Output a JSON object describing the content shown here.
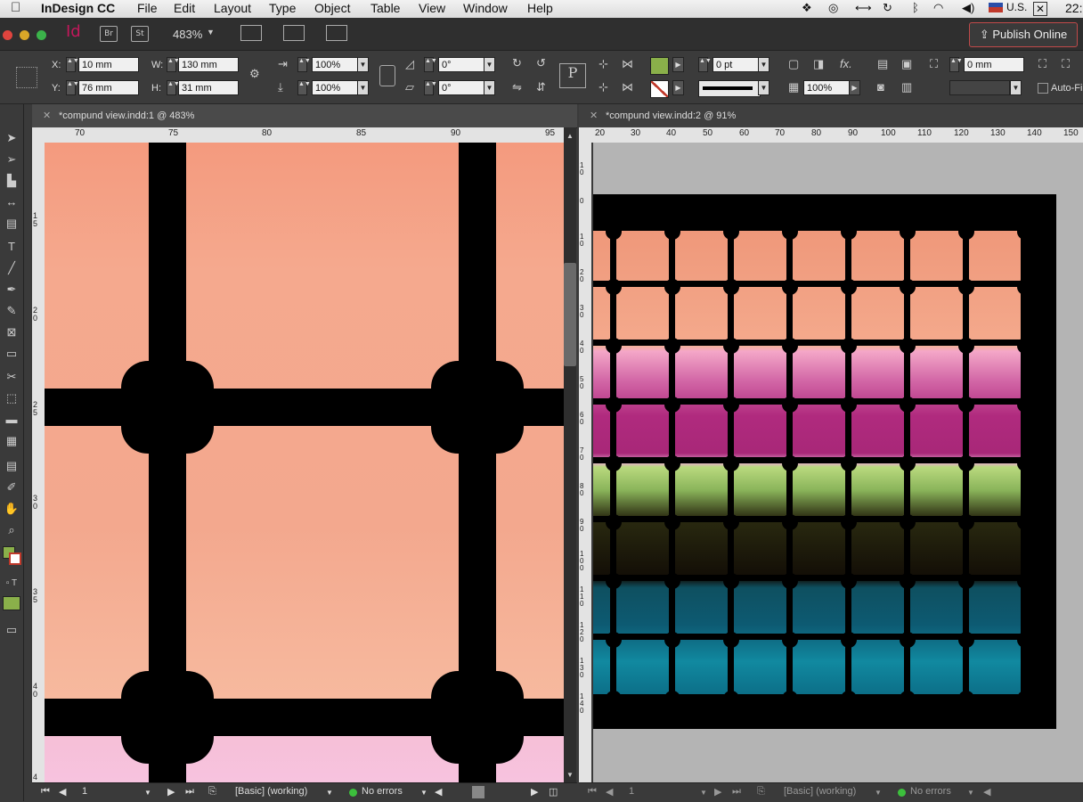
{
  "menubar": {
    "app_name": "InDesign CC",
    "items": [
      "File",
      "Edit",
      "Layout",
      "Type",
      "Object",
      "Table",
      "View",
      "Window",
      "Help"
    ],
    "input_source": "U.S.",
    "clock": "22:"
  },
  "appbar": {
    "logo": "Id",
    "bridge": "Br",
    "stock": "St",
    "zoom": "483%",
    "publish_label": "Publish Online"
  },
  "control": {
    "x_label": "X:",
    "x_value": "10 mm",
    "y_label": "Y:",
    "y_value": "76 mm",
    "w_label": "W:",
    "w_value": "130 mm",
    "h_label": "H:",
    "h_value": "31 mm",
    "scale_x": "100%",
    "scale_y": "100%",
    "rotate": "0°",
    "shear": "0°",
    "stroke_weight": "0 pt",
    "opacity": "100%",
    "offset": "0 mm",
    "auto_fit": "Auto-Fi",
    "fill_color": "#8ab04a",
    "stroke_color": "#c0392b"
  },
  "tabs": {
    "left": "*compund view.indd:1 @ 483%",
    "right": "*compund view.indd:2 @ 91%"
  },
  "ruler_left": {
    "h_ticks": [
      "70",
      "75",
      "80",
      "85",
      "90",
      "95"
    ],
    "v_ticks": [
      "1 5",
      "2 0",
      "2 5",
      "3 0",
      "3 5",
      "4 0",
      "4"
    ]
  },
  "ruler_right": {
    "h_ticks": [
      "20",
      "30",
      "40",
      "50",
      "60",
      "70",
      "80",
      "90",
      "100",
      "110",
      "120",
      "130",
      "140",
      "150"
    ],
    "v_ticks": [
      "1 0",
      "0",
      "1 0",
      "2 0",
      "3 0",
      "4 0",
      "5 0",
      "6 0",
      "7 0",
      "8 0",
      "9 0",
      "1 0 0",
      "1 1 0",
      "1 2 0",
      "1 3 0",
      "1 4 0"
    ]
  },
  "status_left": {
    "page": "1",
    "preflight_profile": "[Basic] (working)",
    "errors": "No errors"
  },
  "status_right": {
    "page": "1",
    "preflight_profile": "[Basic] (working)",
    "errors": "No errors"
  }
}
